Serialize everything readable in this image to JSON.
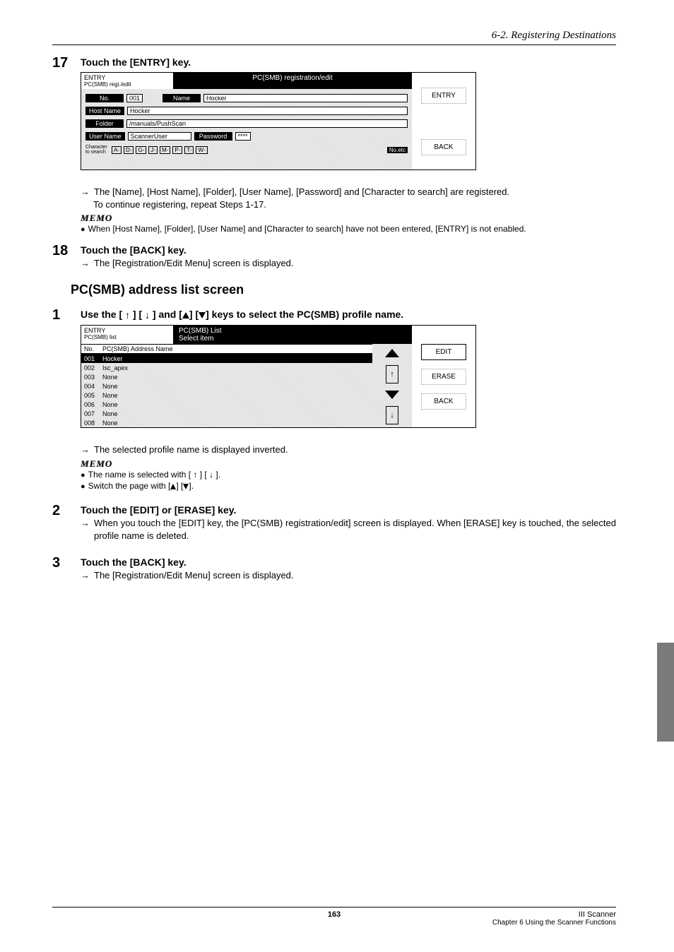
{
  "breadcrumb": "6-2. Registering Destinations",
  "step17": {
    "num": "17",
    "title": "Touch the [ENTRY] key.",
    "panel": {
      "hdr_left_main": "ENTRY",
      "hdr_left_sub": "PC(SMB) regi./edit",
      "hdr_right": "PC(SMB) registration/edit",
      "row_no_label": "No.",
      "row_no_val": "001",
      "row_name_label": "Name",
      "row_name_val": "Hocker",
      "row_host_label": "Host Name",
      "row_host_val": "Hocker",
      "row_folder_label": "Folder",
      "row_folder_val": "/manuals/PushScan",
      "row_user_label": "User Name",
      "row_user_val": "ScannerUser",
      "row_pass_label": "Password",
      "row_pass_val": "****",
      "char_lead": "Character to search",
      "char_tabs": [
        "A-",
        "D-",
        "G-",
        "J-",
        "M-",
        "P-",
        "T-",
        "W-"
      ],
      "char_noetc": "No.etc",
      "btn_entry": "ENTRY",
      "btn_back": "BACK"
    },
    "result": "The [Name], [Host Name], [Folder], [User Name], [Password] and [Character to search] are registered.",
    "cont": "To continue registering, repeat Steps 1-17.",
    "memo_label": "MEMO",
    "memo_text": "When [Host Name], [Folder], [User Name] and [Character to search] have not been entered, [ENTRY] is not enabled."
  },
  "step18": {
    "num": "18",
    "title": "Touch the [BACK] key.",
    "result": "The [Registration/Edit Menu] screen is displayed."
  },
  "section_title": "PC(SMB) address list screen",
  "sub1": {
    "num": "1",
    "title_a": "Use the [ ",
    "title_b": " ] [ ",
    "title_c": " ] and [",
    "title_d": "] [",
    "title_e": "] keys to select the PC(SMB) profile name.",
    "panel": {
      "hdr_left_main": "ENTRY",
      "hdr_left_sub": "PC(SMB) list",
      "hdr_right1": "PC(SMB) List",
      "hdr_right2": "Select item",
      "col1": "No.",
      "col2": "PC(SMB) Address Name",
      "rows": [
        {
          "num": "001",
          "name": "Hocker"
        },
        {
          "num": "002",
          "name": "Isc_apex"
        },
        {
          "num": "003",
          "name": "None"
        },
        {
          "num": "004",
          "name": "None"
        },
        {
          "num": "005",
          "name": "None"
        },
        {
          "num": "006",
          "name": "None"
        },
        {
          "num": "007",
          "name": "None"
        },
        {
          "num": "008",
          "name": "None"
        }
      ],
      "btn_edit": "EDIT",
      "btn_erase": "ERASE",
      "btn_back": "BACK"
    },
    "result": "The selected profile name is displayed inverted.",
    "memo_label": "MEMO",
    "memo1a": "The name is selected with [ ",
    "memo1b": " ] [ ",
    "memo1c": " ].",
    "memo2a": "Switch the page with [",
    "memo2b": "] [",
    "memo2c": "]."
  },
  "sub2": {
    "num": "2",
    "title": "Touch the [EDIT] or [ERASE] key.",
    "result": "When you touch the [EDIT] key, the [PC(SMB) registration/edit] screen is displayed. When [ERASE] key is touched, the selected profile name is deleted."
  },
  "sub3": {
    "num": "3",
    "title": "Touch the [BACK] key.",
    "result": "The [Registration/Edit Menu] screen is displayed."
  },
  "footer": {
    "page": "163",
    "right1": "III Scanner",
    "right2": "Chapter 6 Using the Scanner Functions"
  }
}
